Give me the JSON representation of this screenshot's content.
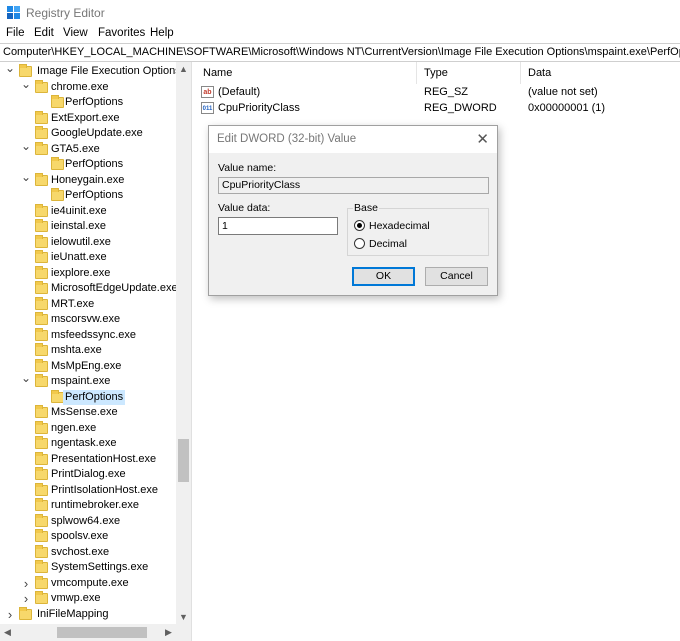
{
  "window": {
    "title": "Registry Editor",
    "icon": "registry-editor-icon"
  },
  "menu": [
    "File",
    "Edit",
    "View",
    "Favorites",
    "Help"
  ],
  "address": "Computer\\HKEY_LOCAL_MACHINE\\SOFTWARE\\Microsoft\\Windows NT\\CurrentVersion\\Image File Execution Options\\mspaint.exe\\PerfOptions",
  "tree": [
    {
      "label": "Image File Execution Options",
      "level": 0,
      "expander": "down"
    },
    {
      "label": "chrome.exe",
      "level": 1,
      "expander": "down"
    },
    {
      "label": "PerfOptions",
      "level": 2,
      "expander": ""
    },
    {
      "label": "ExtExport.exe",
      "level": 1,
      "expander": ""
    },
    {
      "label": "GoogleUpdate.exe",
      "level": 1,
      "expander": ""
    },
    {
      "label": "GTA5.exe",
      "level": 1,
      "expander": "down"
    },
    {
      "label": "PerfOptions",
      "level": 2,
      "expander": ""
    },
    {
      "label": "Honeygain.exe",
      "level": 1,
      "expander": "down"
    },
    {
      "label": "PerfOptions",
      "level": 2,
      "expander": ""
    },
    {
      "label": "ie4uinit.exe",
      "level": 1,
      "expander": ""
    },
    {
      "label": "ieinstal.exe",
      "level": 1,
      "expander": ""
    },
    {
      "label": "ielowutil.exe",
      "level": 1,
      "expander": ""
    },
    {
      "label": "ieUnatt.exe",
      "level": 1,
      "expander": ""
    },
    {
      "label": "iexplore.exe",
      "level": 1,
      "expander": ""
    },
    {
      "label": "MicrosoftEdgeUpdate.exe",
      "level": 1,
      "expander": ""
    },
    {
      "label": "MRT.exe",
      "level": 1,
      "expander": ""
    },
    {
      "label": "mscorsvw.exe",
      "level": 1,
      "expander": ""
    },
    {
      "label": "msfeedssync.exe",
      "level": 1,
      "expander": ""
    },
    {
      "label": "mshta.exe",
      "level": 1,
      "expander": ""
    },
    {
      "label": "MsMpEng.exe",
      "level": 1,
      "expander": ""
    },
    {
      "label": "mspaint.exe",
      "level": 1,
      "expander": "down"
    },
    {
      "label": "PerfOptions",
      "level": 2,
      "expander": "",
      "selected": true
    },
    {
      "label": "MsSense.exe",
      "level": 1,
      "expander": ""
    },
    {
      "label": "ngen.exe",
      "level": 1,
      "expander": ""
    },
    {
      "label": "ngentask.exe",
      "level": 1,
      "expander": ""
    },
    {
      "label": "PresentationHost.exe",
      "level": 1,
      "expander": ""
    },
    {
      "label": "PrintDialog.exe",
      "level": 1,
      "expander": ""
    },
    {
      "label": "PrintIsolationHost.exe",
      "level": 1,
      "expander": ""
    },
    {
      "label": "runtimebroker.exe",
      "level": 1,
      "expander": ""
    },
    {
      "label": "splwow64.exe",
      "level": 1,
      "expander": ""
    },
    {
      "label": "spoolsv.exe",
      "level": 1,
      "expander": ""
    },
    {
      "label": "svchost.exe",
      "level": 1,
      "expander": ""
    },
    {
      "label": "SystemSettings.exe",
      "level": 1,
      "expander": ""
    },
    {
      "label": "vmcompute.exe",
      "level": 1,
      "expander": "right"
    },
    {
      "label": "vmwp.exe",
      "level": 1,
      "expander": "right"
    },
    {
      "label": "IniFileMapping",
      "level": 0,
      "expander": "right"
    }
  ],
  "list": {
    "columns": {
      "name": "Name",
      "type": "Type",
      "data": "Data"
    },
    "rows": [
      {
        "name": "(Default)",
        "type": "REG_SZ",
        "data": "(value not set)",
        "icon": "string-value-icon"
      },
      {
        "name": "CpuPriorityClass",
        "type": "REG_DWORD",
        "data": "0x00000001 (1)",
        "icon": "dword-value-icon"
      }
    ]
  },
  "dialog": {
    "title": "Edit DWORD (32-bit) Value",
    "value_name_label": "Value name:",
    "value_name": "CpuPriorityClass",
    "value_data_label": "Value data:",
    "value_data": "1",
    "base_label": "Base",
    "hex_label": "Hexadecimal",
    "dec_label": "Decimal",
    "selected_base": "hex",
    "ok_label": "OK",
    "cancel_label": "Cancel"
  },
  "colors": {
    "selection": "#cce8ff",
    "accent": "#0078d7",
    "folder": "#f7d86b"
  }
}
